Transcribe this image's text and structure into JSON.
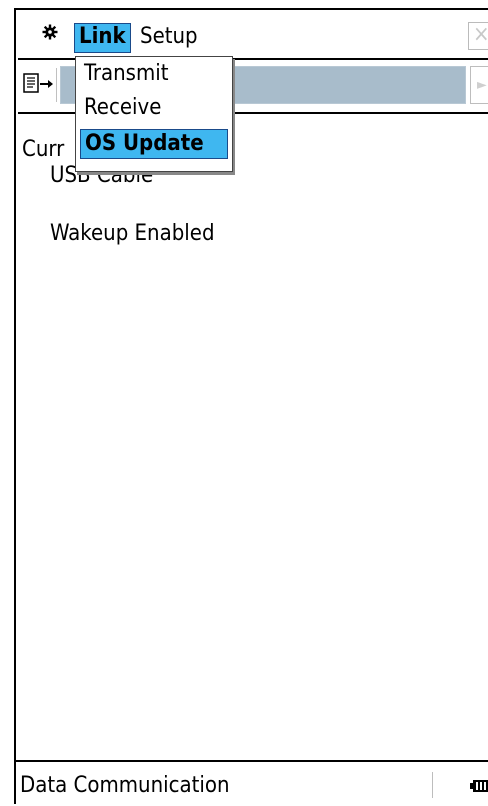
{
  "menubar": {
    "gear_icon": "gear-icon",
    "link_label": "Link",
    "setup_label": "Setup",
    "close_icon": "close-icon"
  },
  "toolbar": {
    "transfer_icon": "transfer-icon",
    "arrow_icon": "arrow-right-icon"
  },
  "link_menu": {
    "items": [
      {
        "label": "Transmit",
        "selected": false
      },
      {
        "label": "Receive",
        "selected": false
      },
      {
        "label": "OS Update",
        "selected": true
      }
    ]
  },
  "content": {
    "line1": "Curr",
    "line2": "USB Cable",
    "line3": "Wakeup Enabled"
  },
  "statusbar": {
    "app_name": "Data Communication",
    "battery_icon": "battery-icon"
  },
  "colors": {
    "highlight": "#3fb7f0",
    "toolbar_field": "#a8bccb"
  }
}
